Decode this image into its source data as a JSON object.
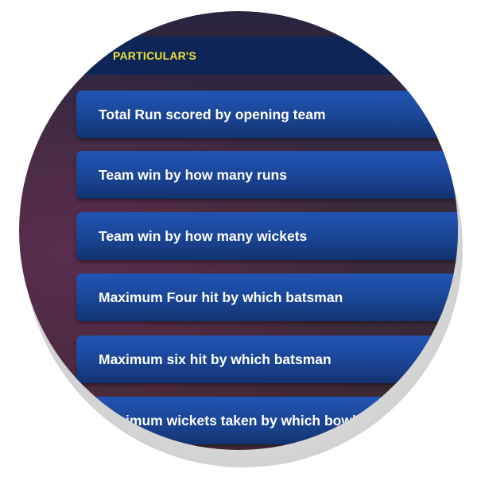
{
  "header": {
    "label": "PARTICULAR'S"
  },
  "list": {
    "items": [
      {
        "label": "Total Run scored by opening team"
      },
      {
        "label": "Team win by how many runs"
      },
      {
        "label": "Team win by how many wickets"
      },
      {
        "label": "Maximum Four hit by which batsman"
      },
      {
        "label": "Maximum six hit by which batsman"
      },
      {
        "label": "Maximum wickets taken by which bowler"
      }
    ]
  },
  "colors": {
    "header_bg": "#0d2657",
    "header_text": "#f2e234",
    "row_bg_top": "#2154b3",
    "row_bg_bottom": "#12336e",
    "row_text": "#ffffff",
    "backdrop": "#3a2a3e"
  }
}
